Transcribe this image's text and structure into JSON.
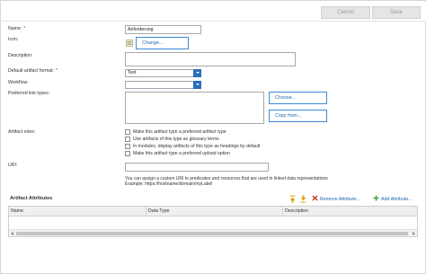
{
  "toolbar": {
    "cancel_label": "Cancel",
    "save_label": "Save"
  },
  "form": {
    "name_label": "Name:",
    "name_value": "Anforderung",
    "required_marker": "*",
    "icon_label": "Icon:",
    "icon_change_label": "Change...",
    "description_label": "Description:",
    "description_value": "",
    "default_format_label": "Default artifact format:",
    "default_format_value": "Text",
    "workflow_label": "Workflow:",
    "workflow_value": "",
    "preferred_link_types_label": "Preferred link types:",
    "choose_label": "Choose...",
    "copy_from_label": "Copy from...",
    "artifact_roles_label": "Artifact roles:",
    "roles": [
      {
        "label": "Make this artifact type a preferred artifact type",
        "checked": false
      },
      {
        "label": "Use artifacts of this type as glossary terms",
        "checked": false
      },
      {
        "label": "In modules, display artifacts of this type as headings by default",
        "checked": false
      },
      {
        "label": "Make this artifact type a preferred upload option",
        "checked": false
      }
    ],
    "uri_label": "URI:",
    "uri_value": "",
    "uri_help_line1": "You can assign a custom URI to predicates and resources that are used in linked data representations",
    "uri_help_line2": "Example: https://hostname/domain/myLabel"
  },
  "attributes": {
    "title": "Artifact Attributes",
    "remove_label": "Remove Attribute...",
    "add_label": "Add Attribute...",
    "columns": [
      "Name",
      "Data Type",
      "Description"
    ],
    "rows": []
  },
  "colors": {
    "accent": "#2a6ebb",
    "link": "#1f66b0",
    "required": "#cc2a2a",
    "move_up_arrow": "#e0a21a",
    "remove_x": "#c0392b",
    "add_plus": "#3a9a3a"
  }
}
